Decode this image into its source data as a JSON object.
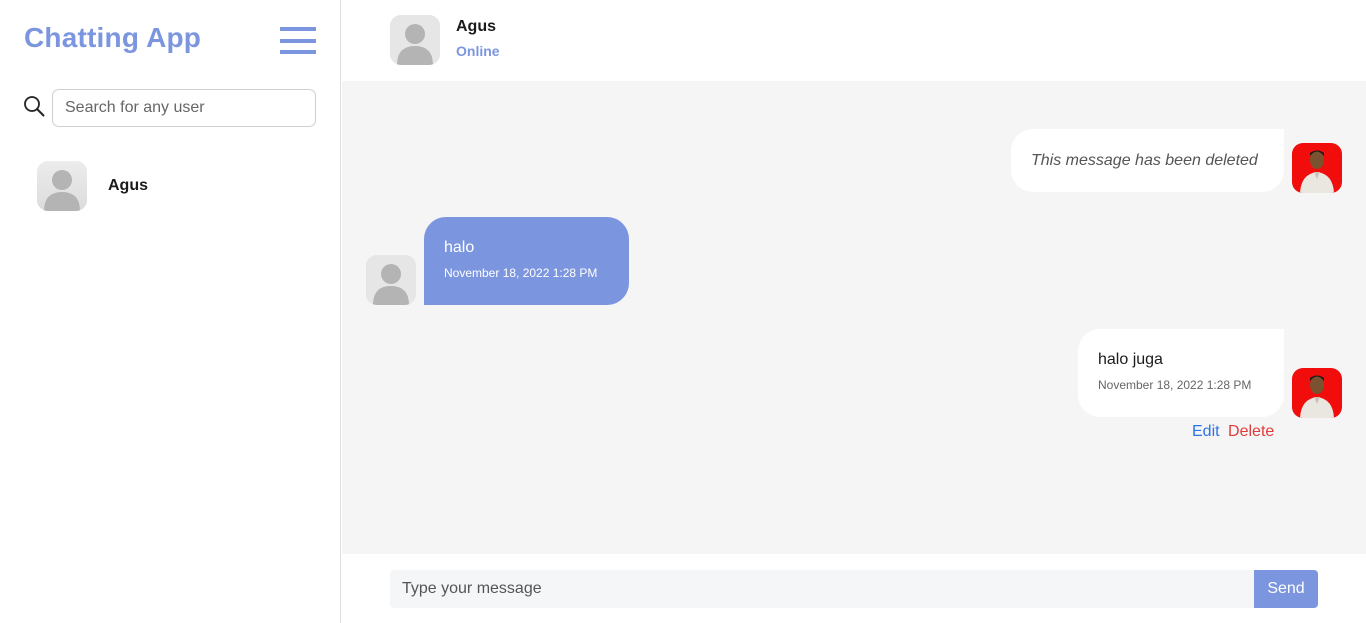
{
  "sidebar": {
    "title": "Chatting App",
    "menu_icon": "hamburger-menu-icon",
    "search": {
      "icon": "search-icon",
      "placeholder": "Search for any user",
      "value": ""
    },
    "users": [
      {
        "name": "Agus",
        "avatar": "default-avatar"
      }
    ]
  },
  "chat": {
    "header": {
      "name": "Agus",
      "status": "Online"
    },
    "messages": [
      {
        "from": "me",
        "text": "This message has been deleted",
        "deleted": true
      },
      {
        "from": "other",
        "text": "halo",
        "time": "November 18, 2022 1:28 PM"
      },
      {
        "from": "me",
        "text": "halo juga",
        "time": "November 18, 2022 1:28 PM"
      }
    ],
    "actions": {
      "edit": "Edit",
      "delete": "Delete"
    }
  },
  "composer": {
    "placeholder": "Type your message",
    "value": "",
    "send_label": "Send"
  },
  "colors": {
    "accent": "#7b96df",
    "edit": "#2e74e4",
    "delete": "#e03c3c",
    "chat_bg": "#f5f5f5"
  }
}
